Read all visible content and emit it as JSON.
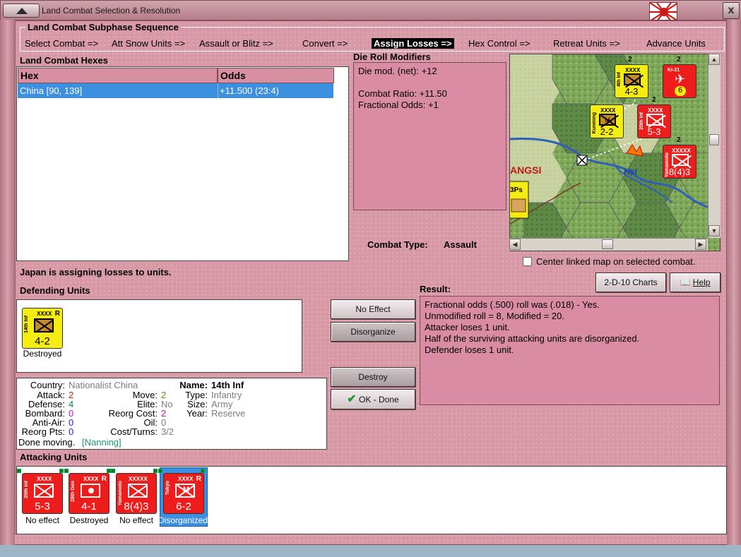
{
  "window": {
    "title": "Land Combat Selection & Resolution",
    "close_glyph": "x"
  },
  "subphase": {
    "title": "Land Combat Subphase Sequence",
    "steps": [
      "Select Combat =>",
      "Att Snow Units =>",
      "Assault or Blitz =>",
      "Convert =>",
      "Assign Losses =>",
      "Hex Control =>",
      "Retreat Units =>",
      "Advance Units"
    ],
    "active_index": 4
  },
  "hexes": {
    "title": "Land Combat Hexes",
    "columns": [
      "Hex",
      "Odds"
    ],
    "rows": [
      {
        "hex": "China [90, 139]",
        "odds": "+11.500 (23:4)"
      }
    ]
  },
  "die_roll": {
    "title": "Die Roll Modifiers",
    "lines": [
      "Die mod. (net): +12",
      "",
      "Combat Ratio: +11.50",
      "Fractional Odds: +1"
    ]
  },
  "combat_type": {
    "label": "Combat Type:",
    "value": "Assault"
  },
  "map": {
    "region_label": "ANGSI",
    "city_label": "Hsi",
    "partial_label": "3Ps",
    "counters": [
      {
        "id": "m1",
        "name": "4th Inf",
        "size": "XXXX",
        "strength": "4-3",
        "color": "yellow",
        "stack": "2"
      },
      {
        "id": "m2",
        "name": "Kunming",
        "size": "XXXX",
        "strength": "2-2",
        "color": "yellow",
        "type": "M"
      },
      {
        "id": "m3",
        "name": "20th Inf",
        "size": "XXXX",
        "strength": "5-3",
        "color": "red",
        "stack": "2"
      },
      {
        "id": "m4",
        "name": "Yamamoto",
        "size": "XXXXX",
        "strength": "8(4)3",
        "color": "red",
        "stack": "2"
      },
      {
        "id": "m5",
        "name": "Ki-21",
        "strength": "6",
        "color": "red",
        "stack": "2"
      }
    ]
  },
  "center_map": {
    "label": "Center linked map on selected combat.",
    "checked": false
  },
  "status_line": "Japan is assigning losses to units.",
  "charts_button": "2-D-10 Charts",
  "help_button": "Help",
  "defending": {
    "title": "Defending Units",
    "units": [
      {
        "name": "14th Inf",
        "size": "XXXX",
        "strength": "4-2",
        "color": "yellow",
        "reserve": "R",
        "status": "Destroyed"
      }
    ]
  },
  "buttons": {
    "no_effect": "No Effect",
    "disorganize": "Disorganize",
    "destroy": "Destroy",
    "ok_done": "OK - Done",
    "ok_icon": "checkmark-icon"
  },
  "result": {
    "title": "Result:",
    "lines": [
      "Fractional odds (.500) roll was (.018)  - Yes.",
      "Unmodified roll = 8, Modified = 20.",
      "Attacker loses 1 unit.",
      "Half of the surviving attacking units are disorganized.",
      "Defender loses 1 unit."
    ]
  },
  "unit_info": {
    "country_label": "Country:",
    "country": "Nationalist China",
    "attack_label": "Attack:",
    "attack": "2",
    "defense_label": "Defense:",
    "defense": "4",
    "bombard_label": "Bombard:",
    "bombard": "0",
    "antiair_label": "Anti-Air:",
    "antiair": "0",
    "reorg_pts_label": "Reorg Pts:",
    "reorg_pts": "0",
    "move_label": "Move:",
    "move": "2",
    "elite_label": "Elite:",
    "elite": "No",
    "reorg_cost_label": "Reorg Cost:",
    "reorg_cost": "2",
    "oil_label": "Oil:",
    "oil": "0",
    "cost_turns_label": "Cost/Turns:",
    "cost_turns": "3/2",
    "name_label": "Name:",
    "name": "14th Inf",
    "type_label": "Type:",
    "type": "Infantry",
    "size_label": "Size:",
    "size": "Army",
    "year_label": "Year:",
    "year": "Reserve",
    "done_moving": "Done moving.",
    "location": "[Nanning]",
    "colors": {
      "attack": "#d0141c",
      "defense": "#0a8a3a",
      "bombard": "#c018c0",
      "antiair": "#2020d0",
      "reorg": "#2020d0",
      "move": "#7a8a00",
      "grey": "#7d7d7d",
      "location": "#1a9a6a"
    }
  },
  "attacking": {
    "title": "Attacking Units",
    "units": [
      {
        "name": "20th Inf",
        "size": "XXXX",
        "strength": "5-3",
        "status": "No effect",
        "type": "inf"
      },
      {
        "name": "28th Gen",
        "size": "XXXX",
        "strength": "4-1",
        "status": "Destroyed",
        "reserve": "R",
        "type": "gen"
      },
      {
        "name": "Yamamoto",
        "size": "XXXXX",
        "strength": "8(4)3",
        "status": "No effect",
        "type": "inf"
      },
      {
        "name": "Tokyo",
        "size": "XXXX",
        "strength": "6-2",
        "status": "Disorganized",
        "reserve": "R",
        "type": "mech",
        "selected": true
      }
    ]
  }
}
